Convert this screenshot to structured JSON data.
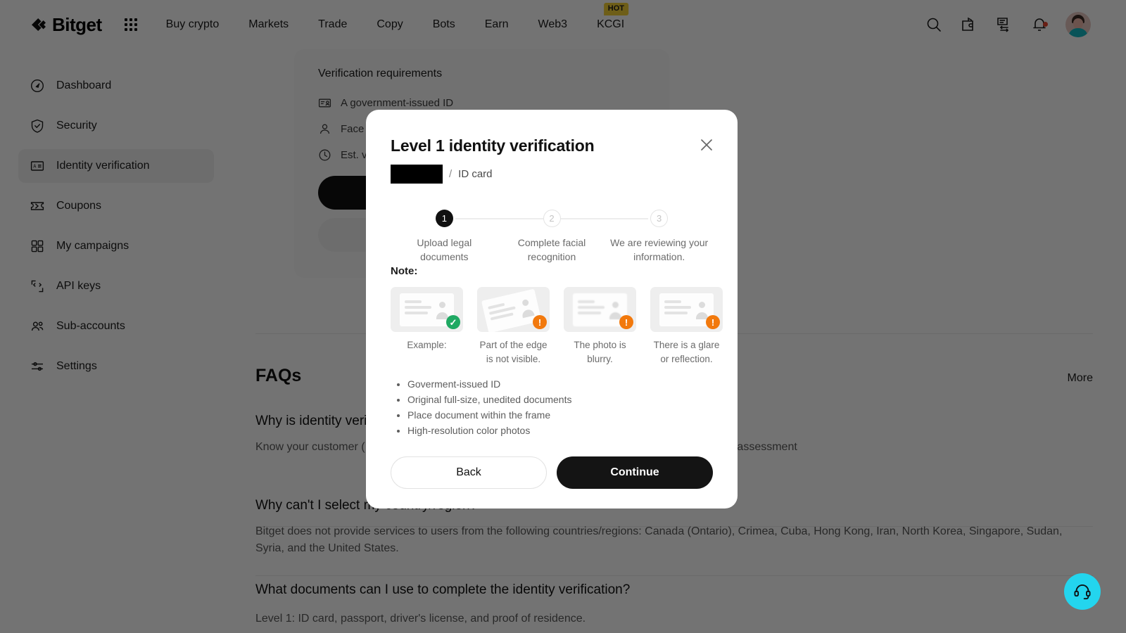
{
  "header": {
    "brand": "Bitget",
    "nav": [
      {
        "label": "Buy crypto",
        "badge": null
      },
      {
        "label": "Markets",
        "badge": null
      },
      {
        "label": "Trade",
        "badge": null
      },
      {
        "label": "Copy",
        "badge": null
      },
      {
        "label": "Bots",
        "badge": null
      },
      {
        "label": "Earn",
        "badge": null
      },
      {
        "label": "Web3",
        "badge": null
      },
      {
        "label": "KCGI",
        "badge": "HOT"
      }
    ],
    "icons": [
      "search-icon",
      "wallet-icon",
      "orders-icon",
      "notification-bell-icon",
      "avatar"
    ]
  },
  "sidebar": {
    "items": [
      {
        "label": "Dashboard",
        "icon": "compass-icon",
        "active": false
      },
      {
        "label": "Security",
        "icon": "shield-check-icon",
        "active": false
      },
      {
        "label": "Identity verification",
        "icon": "id-card-icon",
        "active": true
      },
      {
        "label": "Coupons",
        "icon": "ticket-icon",
        "active": false
      },
      {
        "label": "My campaigns",
        "icon": "grid-squares-icon",
        "active": false
      },
      {
        "label": "API keys",
        "icon": "code-brackets-icon",
        "active": false
      },
      {
        "label": "Sub-accounts",
        "icon": "users-icon",
        "active": false
      },
      {
        "label": "Settings",
        "icon": "sliders-icon",
        "active": false
      }
    ]
  },
  "requirements": {
    "title": "Verification requirements",
    "rows": [
      {
        "icon": "id-card-icon",
        "text": "A government-issued ID"
      },
      {
        "icon": "person-icon",
        "text": "Face"
      },
      {
        "icon": "clock-icon",
        "text": "Est. ve"
      }
    ],
    "primary_button": "",
    "secondary_button": ""
  },
  "faq": {
    "title": "FAQs",
    "more": "More",
    "items": [
      {
        "question": "Why is identity verif",
        "answer": "Know your customer (                                                                                                                  ons to verify your identity. Bitget will verify your identity and conduct a risk assessment "
      },
      {
        "question": "Why can't I select my country/region?",
        "answer": "Bitget does not provide services to users from the following countries/regions: Canada (Ontario), Crimea, Cuba, Hong Kong, Iran, North Korea, Singapore, Sudan, Syria, and the United States."
      },
      {
        "question": "What documents can I use to complete the identity verification?",
        "answer": "Level 1: ID card, passport, driver's license, and proof of residence."
      }
    ],
    "caret_icon": "chevron-down-icon"
  },
  "support": {
    "icon": "headset-icon",
    "color": "#23d5ee"
  },
  "modal": {
    "title": "Level 1 identity verification",
    "redacted_value": "",
    "separator": "/",
    "document_type": "ID card",
    "close_icon": "close-icon",
    "steps": [
      {
        "number": "1",
        "label": "Upload legal documents",
        "state": "current"
      },
      {
        "number": "2",
        "label": "Complete facial recognition",
        "state": "todo"
      },
      {
        "number": "3",
        "label": "We are reviewing your information.",
        "state": "todo"
      }
    ],
    "note_label": "Note:",
    "thumbnails": [
      {
        "caption": "Example:",
        "badge": "ok",
        "badge_icon": "check-circle-icon",
        "tilted": false
      },
      {
        "caption": "Part of the edge is not visible.",
        "badge": "warn",
        "badge_icon": "warning-circle-icon",
        "tilted": true
      },
      {
        "caption": "The photo is blurry.",
        "badge": "warn",
        "badge_icon": "warning-circle-icon",
        "tilted": false
      },
      {
        "caption": "There is a glare or reflection.",
        "badge": "warn",
        "badge_icon": "warning-circle-icon",
        "tilted": false
      }
    ],
    "bullets": [
      "Goverment-issued ID",
      "Original full-size, unedited documents",
      "Place document within the frame",
      "High-resolution color photos"
    ],
    "back_label": "Back",
    "continue_label": "Continue"
  },
  "colors": {
    "accent_dark": "#111111",
    "hot_badge": "#f4d035",
    "success": "#1fa963",
    "warning": "#f2790d",
    "support": "#23d5ee",
    "notification_dot": "#e8452f"
  }
}
